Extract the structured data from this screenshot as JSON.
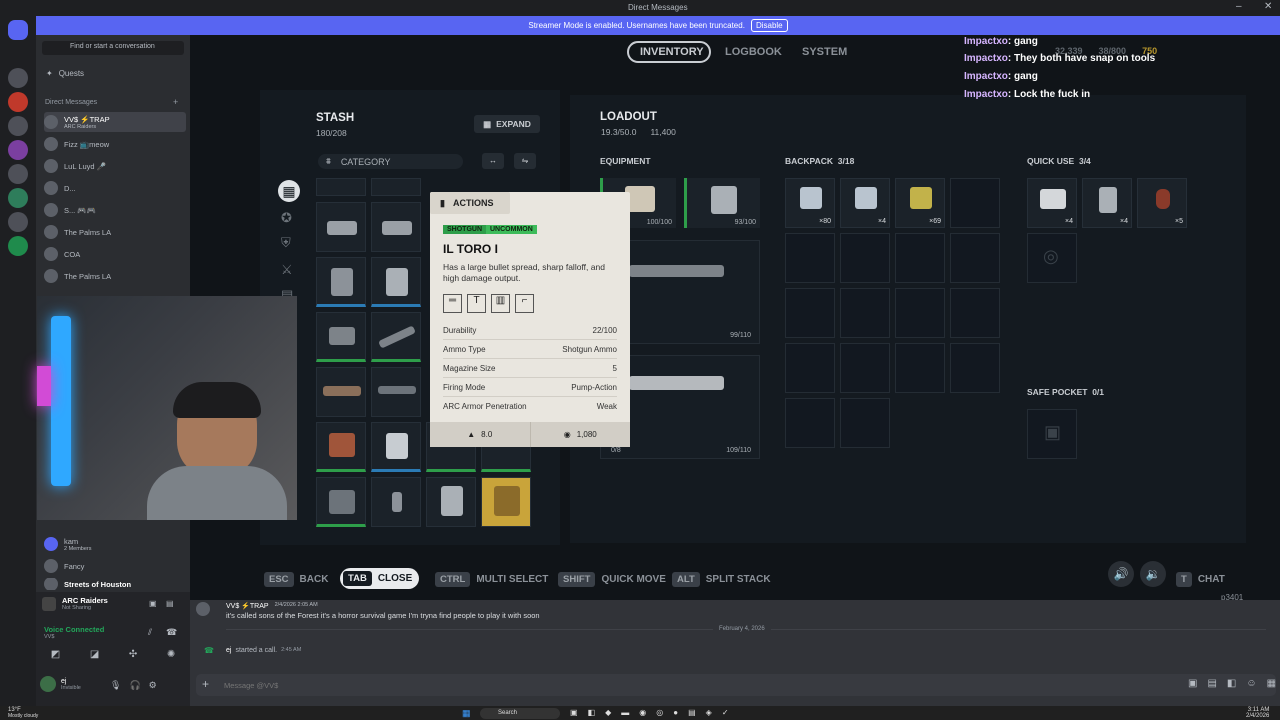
{
  "titlebar": {
    "title": "Direct Messages",
    "time": "3:11 AM",
    "date": "2/4/2026"
  },
  "banner": {
    "text": "Streamer Mode is enabled. Usernames have been truncated.",
    "button": "Disable"
  },
  "sidebar": {
    "search": "Find or start a conversation",
    "quests": "Quests",
    "dm_header": "Direct Messages",
    "dms": [
      {
        "name": "VV$ ⚡TRAP",
        "sub": "ARC Raiders"
      },
      {
        "name": "Fizz 📺meow",
        "sub": ""
      },
      {
        "name": "LuL Luyd 🎤",
        "sub": ""
      },
      {
        "name": "D...",
        "sub": ""
      },
      {
        "name": "S... 🎮🎮",
        "sub": ""
      },
      {
        "name": "The Palms LA",
        "sub": ""
      },
      {
        "name": "COA",
        "sub": ""
      },
      {
        "name": "The Palms LA",
        "sub": ""
      },
      {
        "name": "kam",
        "sub": "2 Members"
      },
      {
        "name": "Fancy",
        "sub": ""
      },
      {
        "name": "Streets of Houston",
        "sub": ""
      }
    ],
    "activity": {
      "title": "ARC Raiders",
      "sub": "Not Sharing"
    },
    "voice": {
      "title": "Voice Connected",
      "sub": "VV$"
    },
    "user": {
      "name": "ej",
      "status": "Invisible"
    }
  },
  "game": {
    "tabs": [
      "INVENTORY",
      "LOGBOOK",
      "SYSTEM"
    ],
    "currency": {
      "a": "32,339",
      "b": "38/800",
      "c": "750"
    },
    "stash": {
      "title": "STASH",
      "count": "180/208",
      "expand": "EXPAND",
      "category": "CATEGORY"
    },
    "loadout": {
      "title": "LOADOUT",
      "weight": "19.3/50.0",
      "value": "11,400"
    },
    "equipment": {
      "label": "EQUIPMENT",
      "slot1": "100/100",
      "slot2": "93/100",
      "weapon1_ammo": "99/110",
      "weapon2_mag": "0/8",
      "weapon2_ammo": "109/110"
    },
    "backpack": {
      "label": "BACKPACK",
      "count": "3/18",
      "counts": [
        "×80",
        "×4",
        "×69"
      ]
    },
    "quickuse": {
      "label": "QUICK USE",
      "count": "3/4",
      "counts": [
        "×4",
        "×4",
        "×5"
      ]
    },
    "safepocket": {
      "label": "SAFE POCKET",
      "count": "0/1"
    },
    "hints": [
      {
        "key": "ESC",
        "label": "BACK"
      },
      {
        "key": "TAB",
        "label": "CLOSE"
      },
      {
        "key": "CTRL",
        "label": "MULTI SELECT"
      },
      {
        "key": "SHIFT",
        "label": "QUICK MOVE"
      },
      {
        "key": "ALT",
        "label": "SPLIT STACK"
      },
      {
        "key": "T",
        "label": "CHAT"
      }
    ],
    "player_id": "p3401",
    "tooltip": {
      "actions": "ACTIONS",
      "tag1": "SHOTGUN",
      "tag2": "UNCOMMON",
      "name": "IL TORO I",
      "desc": "Has a large bullet spread, sharp falloff, and high damage output.",
      "stats": [
        {
          "k": "Durability",
          "v": "22/100"
        },
        {
          "k": "Ammo Type",
          "v": "Shotgun Ammo"
        },
        {
          "k": "Magazine Size",
          "v": "5"
        },
        {
          "k": "Firing Mode",
          "v": "Pump-Action"
        },
        {
          "k": "ARC Armor Penetration",
          "v": "Weak"
        }
      ],
      "weight": "8.0",
      "value": "1,080"
    }
  },
  "twitch_chat": [
    {
      "user": "Impactxo",
      "msg": ": gang"
    },
    {
      "user": "Impactxo",
      "msg": ": They both have snap on tools"
    },
    {
      "user": "Impactxo",
      "msg": ": gang"
    },
    {
      "user": "Impactxo",
      "msg": ": Lock the fuck in"
    }
  ],
  "messages": {
    "author": "VV$ ⚡TRAP",
    "stamp": "2/4/2026 2:05 AM",
    "text": "it's called sons of the Forest it's a horror survival game I'm tryna find people to play it with soon",
    "divider": "February 4, 2026",
    "call": "started a call.",
    "call_user": "ej",
    "call_time": "2:45 AM",
    "input_placeholder": "Message @VV$"
  },
  "taskbar": {
    "weather": "13°F",
    "weather_sub": "Mostly cloudy",
    "search": "Search"
  }
}
